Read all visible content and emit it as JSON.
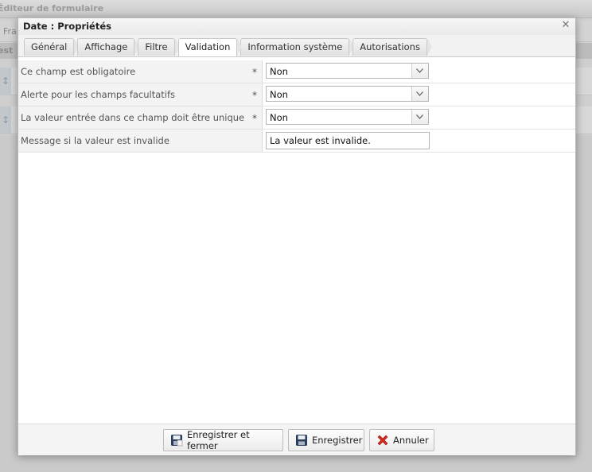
{
  "background": {
    "window_title": "Éditeur de formulaire",
    "toolbar_fragment": "Fra",
    "header_fragment": "est"
  },
  "dialog": {
    "title": "Date : Propriétés",
    "close_icon": "close-icon"
  },
  "tabs": [
    {
      "label": "Général",
      "active": false
    },
    {
      "label": "Affichage",
      "active": false
    },
    {
      "label": "Filtre",
      "active": false
    },
    {
      "label": "Validation",
      "active": true
    },
    {
      "label": "Information système",
      "active": false
    },
    {
      "label": "Autorisations",
      "active": false
    }
  ],
  "fields": [
    {
      "label": "Ce champ est obligatoire",
      "required_mark": "*",
      "type": "select",
      "value": "Non"
    },
    {
      "label": "Alerte pour les champs facultatifs",
      "required_mark": "*",
      "type": "select",
      "value": "Non"
    },
    {
      "label": "La valeur entrée dans ce champ doit être unique",
      "required_mark": "*",
      "type": "select",
      "value": "Non"
    },
    {
      "label": "Message si la valeur est invalide",
      "required_mark": "",
      "type": "text",
      "value": "La valeur est invalide."
    }
  ],
  "footer": {
    "save_close_label": "Enregistrer et fermer",
    "save_label": "Enregistrer",
    "cancel_label": "Annuler"
  },
  "colors": {
    "cancel_icon": "#d42a1e",
    "save_icon": "#2a3e5c"
  }
}
